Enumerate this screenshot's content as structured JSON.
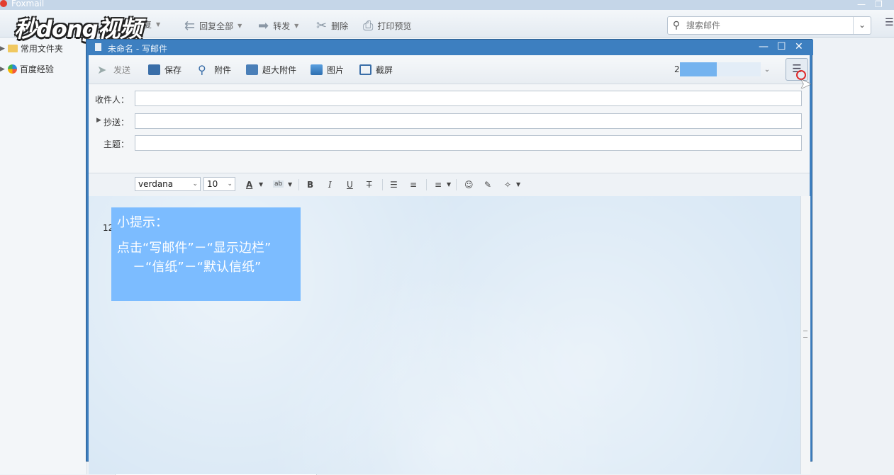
{
  "app": {
    "title": "Foxmail"
  },
  "watermark": "秒dong视频",
  "main_toolbar": {
    "reply": "回复",
    "reply_all": "回复全部",
    "forward": "转发",
    "delete": "删除",
    "print_preview": "打印预览"
  },
  "search": {
    "placeholder": "搜索邮件"
  },
  "sidebar": {
    "items": [
      {
        "label": "常用文件夹"
      },
      {
        "label": "百度经验"
      }
    ]
  },
  "compose": {
    "title": "未命名 - 写邮件",
    "toolbar": {
      "send": "发送",
      "save": "保存",
      "attachment": "附件",
      "large_attachment": "超大附件",
      "image": "图片",
      "screenshot": "截屏"
    },
    "signature_value": "2",
    "fields": {
      "to_label": "收件人：",
      "cc_label": "抄送：",
      "subject_label": "主题："
    },
    "format": {
      "font": "verdana",
      "size": "10",
      "bold": "B",
      "italic": "I",
      "underline": "U",
      "strike": "T"
    },
    "body_text": "12"
  },
  "tip": {
    "heading": "小提示：",
    "line1": "点击“写邮件”－“显示边栏”",
    "line2": "－“信纸”－“默认信纸”"
  },
  "colors": {
    "compose_frame": "#3d7fc0",
    "tip_background": "#7cbcff",
    "signature_highlight": "#74b3ef",
    "click_marker": "#e02a2a"
  }
}
